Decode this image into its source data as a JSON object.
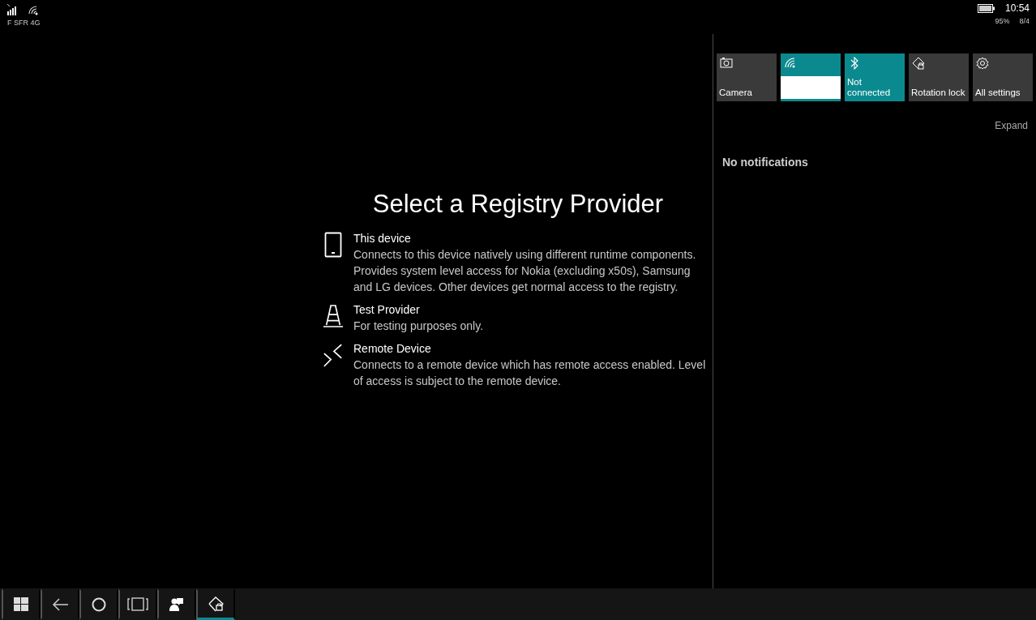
{
  "status_bar": {
    "carrier": "F SFR 4G",
    "time": "10:54",
    "battery_percent": "95%",
    "date": "8/4"
  },
  "app": {
    "title": "Select a Registry Provider",
    "providers": [
      {
        "kind": "phone",
        "name": "This device",
        "description": "Connects to this device natively using different runtime components. Provides system level access for Nokia (excluding x50s), Samsung and LG devices. Other devices get normal access to the registry."
      },
      {
        "kind": "cone",
        "name": "Test Provider",
        "description": "For testing purposes only."
      },
      {
        "kind": "remote",
        "name": "Remote Device",
        "description": "Connects to a remote device which has remote access enabled. Level of access is subject to the remote device."
      }
    ]
  },
  "action_center": {
    "quick_actions": [
      {
        "kind": "camera",
        "label": "Camera",
        "on": false
      },
      {
        "kind": "wifi",
        "on": true
      },
      {
        "kind": "bluetooth",
        "label": "Not connected",
        "on": true
      },
      {
        "kind": "rotation",
        "label": "Rotation lock",
        "on": false
      },
      {
        "kind": "settings",
        "label": "All settings",
        "on": false
      }
    ],
    "expand": "Expand",
    "empty_message": "No notifications"
  },
  "taskbar": {
    "items": [
      {
        "kind": "start",
        "selected": false
      },
      {
        "kind": "back",
        "selected": false
      },
      {
        "kind": "search",
        "selected": false
      },
      {
        "kind": "taskview",
        "selected": false
      },
      {
        "kind": "contact",
        "selected": false
      },
      {
        "kind": "rotation",
        "selected": true
      }
    ]
  }
}
